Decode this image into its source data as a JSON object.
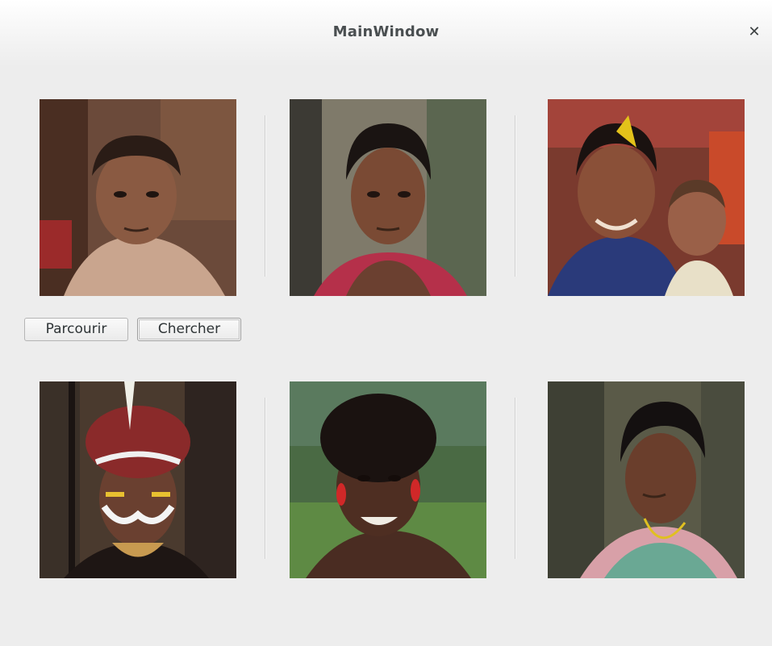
{
  "window": {
    "title": "MainWindow",
    "close_glyph": "✕"
  },
  "buttons": {
    "browse_label": "Parcourir",
    "search_label": "Chercher"
  },
  "colors": {
    "window_bg": "#ededed",
    "title_text": "#4a4f51"
  }
}
